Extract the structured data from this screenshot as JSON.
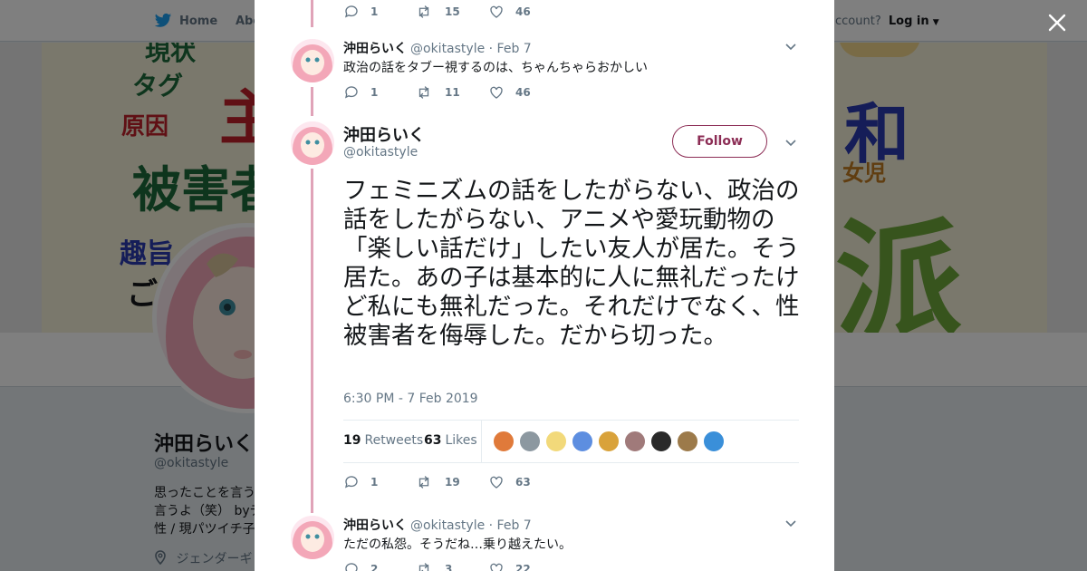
{
  "background": {
    "nav": {
      "home": "Home",
      "about": "Abo",
      "account_prompt": "ccount?",
      "login": "Log in"
    },
    "banner_words": [
      "現状",
      "タグ",
      "主",
      "原因",
      "被害者",
      "趣旨",
      "ご",
      "和",
      "女児",
      "派"
    ],
    "profile": {
      "name": "沖田らいく",
      "handle": "@okitastyle",
      "bio_lines": [
        "思ったことを言う",
        "言うよ（笑） byデ",
        "性 / 現パツイチ子"
      ],
      "location": "ジェンダーギ"
    }
  },
  "modal": {
    "close_label": "×",
    "prev_tweet_actions": {
      "replies": "1",
      "retweets": "15",
      "likes": "46"
    },
    "tweet_a": {
      "name": "沖田らいく",
      "handle": "@okitastyle",
      "date": "· Feb 7",
      "text": "政治の話をタブー視するのは、ちゃんちゃらおかしい",
      "replies": "1",
      "retweets": "11",
      "likes": "46"
    },
    "main_tweet": {
      "name": "沖田らいく",
      "handle": "@okitastyle",
      "follow_label": "Follow",
      "text": "フェミニズムの話をしたがらない、政治の話をしたがらない、アニメや愛玩動物の「楽しい話だけ」したい友人が居た。そう居た。あの子は基本的に人に無礼だったけど私にも無礼だった。それだけでなく、性被害者を侮辱した。だから切った。",
      "timestamp": "6:30 PM - 7 Feb 2019",
      "retweet_count": "19",
      "retweet_label": "Retweets",
      "like_count": "63",
      "like_label": "Likes",
      "replies": "1",
      "retweets": "19",
      "likes": "63",
      "liker_colors": [
        "#e07a3a",
        "#8c98a0",
        "#f2d97a",
        "#5d8ee0",
        "#d9a23a",
        "#a07a7a",
        "#2a2a2a",
        "#9c7a4a",
        "#3a8fd9"
      ]
    },
    "tweet_b": {
      "name": "沖田らいく",
      "handle": "@okitastyle",
      "date": "· Feb 7",
      "text": "ただの私怨。そうだね…乗り越えたい。",
      "replies": "2",
      "retweets": "3",
      "likes": "22"
    }
  },
  "colors": {
    "accent": "#8c2d55",
    "thread": "#e0a3b8",
    "muted": "#657786",
    "twitter_blue": "#1da1f2"
  }
}
